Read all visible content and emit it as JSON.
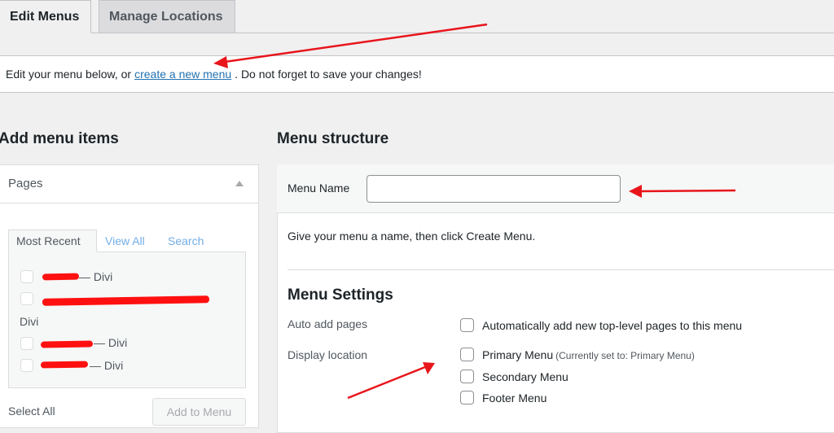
{
  "tabs": [
    {
      "label": "Edit Menus",
      "active": true
    },
    {
      "label": "Manage Locations",
      "active": false
    }
  ],
  "notice": {
    "prefix": "Edit your menu below, or",
    "link": "create a new menu",
    "suffix": ". Do not forget to save your changes!"
  },
  "add_items": {
    "title": "Add menu items",
    "section": "Pages",
    "subtabs": [
      "Most Recent",
      "View All",
      "Search"
    ],
    "items": [
      "— Divi",
      "Divi",
      "— Divi",
      "— Divi"
    ],
    "select_all": "Select All",
    "add_button": "Add to Menu"
  },
  "structure": {
    "title": "Menu structure",
    "menu_name_label": "Menu Name",
    "menu_name_value": "",
    "instructions": "Give your menu a name, then click Create Menu.",
    "settings_title": "Menu Settings",
    "auto_add_label": "Auto add pages",
    "auto_add_option": "Automatically add new top-level pages to this menu",
    "display_location_label": "Display location",
    "locations": [
      {
        "label": "Primary Menu",
        "note": "(Currently set to: Primary Menu)",
        "checked": false
      },
      {
        "label": "Secondary Menu",
        "note": "",
        "checked": false
      },
      {
        "label": "Footer Menu",
        "note": "",
        "checked": false
      }
    ]
  },
  "colors": {
    "accent": "#2271b1",
    "annotation": "#e8151b"
  }
}
